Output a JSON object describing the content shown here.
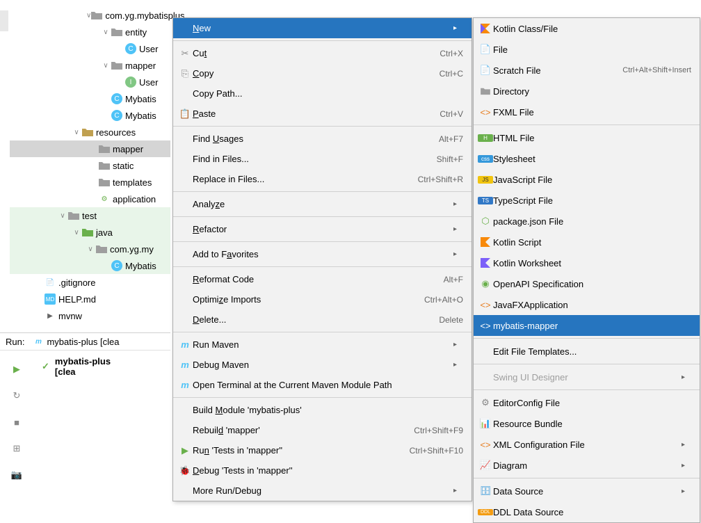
{
  "editor_text": "",
  "tree": {
    "item1": "com.yg.mybatisplus",
    "item2": "entity",
    "item3": "User",
    "item4": "mapper",
    "item5": "User",
    "item6": "Mybatis",
    "item7": "Mybatis",
    "item8": "resources",
    "item9": "mapper",
    "item10": "static",
    "item11": "templates",
    "item12": "application",
    "item13": "test",
    "item14": "java",
    "item15": "com.yg.my",
    "item16": "Mybatis",
    "item17": ".gitignore",
    "item18": "HELP.md",
    "item19": "mvnw"
  },
  "run": {
    "label": "Run:",
    "config": "mybatis-plus [clea",
    "result": "mybatis-plus [clea"
  },
  "context_menu": {
    "new": "New",
    "cut": "Cut",
    "copy": "Copy",
    "copy_path": "Copy Path...",
    "paste": "Paste",
    "find_usages": "Find Usages",
    "find_in_files": "Find in Files...",
    "replace_in_files": "Replace in Files...",
    "analyze": "Analyze",
    "refactor": "Refactor",
    "add_favorites": "Add to Favorites",
    "reformat": "Reformat Code",
    "optimize": "Optimize Imports",
    "delete": "Delete...",
    "run_maven": "Run Maven",
    "debug_maven": "Debug Maven",
    "open_terminal": "Open Terminal at the Current Maven Module Path",
    "build_module": "Build Module 'mybatis-plus'",
    "rebuild": "Rebuild 'mapper'",
    "run_tests": "Run 'Tests in 'mapper''",
    "debug_tests": "Debug 'Tests in 'mapper''",
    "more_run": "More Run/Debug",
    "shortcuts": {
      "cut": "Ctrl+X",
      "copy": "Ctrl+C",
      "paste": "Ctrl+V",
      "find_usages": "Alt+F7",
      "find_in_files": "Shift+F",
      "replace_in_files": "Ctrl+Shift+R",
      "reformat": "Alt+F",
      "optimize": "Ctrl+Alt+O",
      "delete": "Delete",
      "rebuild": "Ctrl+Shift+F9",
      "run_tests": "Ctrl+Shift+F10"
    }
  },
  "submenu": {
    "kotlin_class": "Kotlin Class/File",
    "file": "File",
    "scratch": "Scratch File",
    "scratch_shortcut": "Ctrl+Alt+Shift+Insert",
    "directory": "Directory",
    "fxml": "FXML File",
    "html": "HTML File",
    "stylesheet": "Stylesheet",
    "javascript": "JavaScript File",
    "typescript": "TypeScript File",
    "package_json": "package.json File",
    "kotlin_script": "Kotlin Script",
    "kotlin_worksheet": "Kotlin Worksheet",
    "openapi": "OpenAPI Specification",
    "javafx": "JavaFXApplication",
    "mybatis_mapper": "mybatis-mapper",
    "edit_templates": "Edit File Templates...",
    "swing": "Swing UI Designer",
    "editorconfig": "EditorConfig File",
    "resource_bundle": "Resource Bundle",
    "xml_config": "XML Configuration File",
    "diagram": "Diagram",
    "data_source": "Data Source",
    "ddl": "DDL Data Source"
  }
}
